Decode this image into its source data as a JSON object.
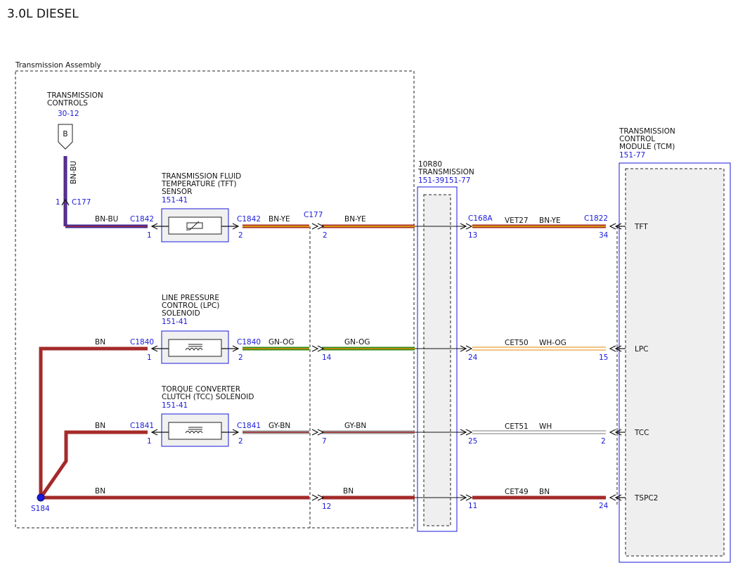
{
  "title": "3.0L DIESEL",
  "colors": {
    "reference_blue": "#1a1adb",
    "wire_BN": "#a52a2a",
    "wire_BU": "#3b2a9e",
    "wire_YE": "#e8c000",
    "wire_GN": "#2e8b1e",
    "wire_OG": "#e58a00",
    "wire_GY": "#9a9a9a",
    "wire_WH": "#ffffff",
    "module_fill": "#efefef"
  },
  "assembly": {
    "label": "Transmission Assembly"
  },
  "trans_controls": {
    "line1": "TRANSMISSION",
    "line2": "CONTROLS",
    "ref": "30-12",
    "connector_letter": "B",
    "wire_color": "BN-BU",
    "pin": "1",
    "connector": "C177"
  },
  "tft_sensor": {
    "line1": "TRANSMISSION FLUID",
    "line2": "TEMPERATURE (TFT)",
    "line3": "SENSOR",
    "ref": "151-41",
    "left_wire": "BN-BU",
    "left_connector": "C1842",
    "left_pin": "1",
    "right_connector": "C1842",
    "right_wire": "BN-YE",
    "right_pin": "2",
    "inline_connector": "C177",
    "inline_pin": "2",
    "inline_wire": "BN-YE"
  },
  "lpc_solenoid": {
    "line1": "LINE PRESSURE",
    "line2": "CONTROL (LPC)",
    "line3": "SOLENOID",
    "ref": "151-41",
    "left_wire": "BN",
    "left_connector": "C1840",
    "left_pin": "1",
    "right_connector": "C1840",
    "right_wire": "GN-OG",
    "right_pin": "2",
    "inline_pin": "14",
    "inline_wire": "GN-OG"
  },
  "tcc_solenoid": {
    "line1": "TORQUE CONVERTER",
    "line2": "CLUTCH (TCC) SOLENOID",
    "ref": "151-41",
    "left_wire": "BN",
    "left_connector": "C1841",
    "left_pin": "1",
    "right_connector": "C1841",
    "right_wire": "GY-BN",
    "right_pin": "2",
    "inline_pin": "7",
    "inline_wire": "GY-BN"
  },
  "ground_row": {
    "left_wire": "BN",
    "inline_pin": "12",
    "inline_wire": "BN",
    "splice": "S184"
  },
  "transmission": {
    "line1": "10R80",
    "line2": "TRANSMISSION",
    "ref": "151-39151-77"
  },
  "tcm": {
    "line1": "TRANSMISSION",
    "line2": "CONTROL",
    "line3": "MODULE (TCM)",
    "ref": "151-77"
  },
  "circuits": [
    {
      "connector_left": "C168A",
      "pin_left": "13",
      "circuit": "VET27",
      "wire": "BN-YE",
      "connector_right": "C1822",
      "pin_right": "34",
      "signal": "TFT"
    },
    {
      "pin_left": "24",
      "circuit": "CET50",
      "wire": "WH-OG",
      "pin_right": "15",
      "signal": "LPC"
    },
    {
      "pin_left": "25",
      "circuit": "CET51",
      "wire": "WH",
      "pin_right": "2",
      "signal": "TCC"
    },
    {
      "pin_left": "11",
      "circuit": "CET49",
      "wire": "BN",
      "pin_right": "24",
      "signal": "TSPC2"
    }
  ]
}
